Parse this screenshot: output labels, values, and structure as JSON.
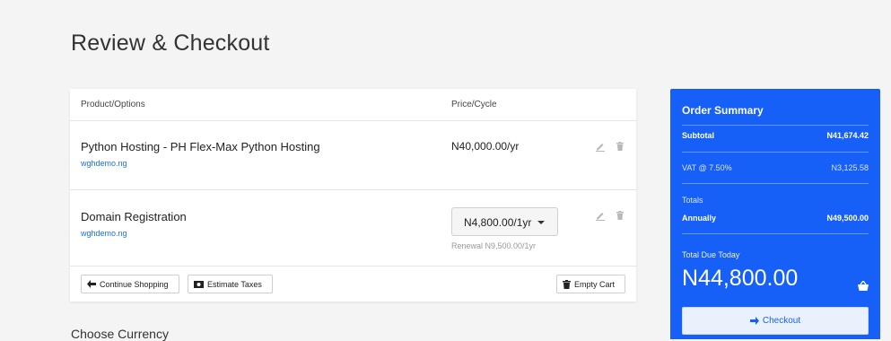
{
  "page": {
    "title": "Review & Checkout"
  },
  "cart": {
    "headers": {
      "product": "Product/Options",
      "price": "Price/Cycle"
    },
    "items": [
      {
        "name": "Python Hosting - PH Flex-Max Python Hosting",
        "domain": "wghdemo.ng",
        "price": "N40,000.00/yr"
      },
      {
        "name": "Domain Registration",
        "domain": "wghdemo.ng",
        "price_select": "N4,800.00/1yr",
        "renewal": "Renewal N9,500.00/1yr"
      }
    ],
    "actions": {
      "continue_shopping": "Continue Shopping",
      "estimate_taxes": "Estimate Taxes",
      "empty_cart": "Empty Cart"
    }
  },
  "currency": {
    "heading": "Choose Currency"
  },
  "summary": {
    "title": "Order Summary",
    "subtotal_label": "Subtotal",
    "subtotal_value": "N41,674.42",
    "vat_label": "VAT @ 7.50%",
    "vat_value": "N3,125.58",
    "totals_label": "Totals",
    "annually_label": "Annually",
    "annually_value": "N49,500.00",
    "total_due_label": "Total Due Today",
    "total_due_value": "N44,800.00",
    "checkout_label": "Checkout"
  },
  "colors": {
    "accent": "#1760f7",
    "link": "#1c6fd8",
    "background": "#f4f4f4"
  },
  "icons": [
    "edit-icon",
    "trash-icon",
    "arrow-left-icon",
    "money-icon",
    "basket-icon",
    "arrow-right-icon"
  ]
}
